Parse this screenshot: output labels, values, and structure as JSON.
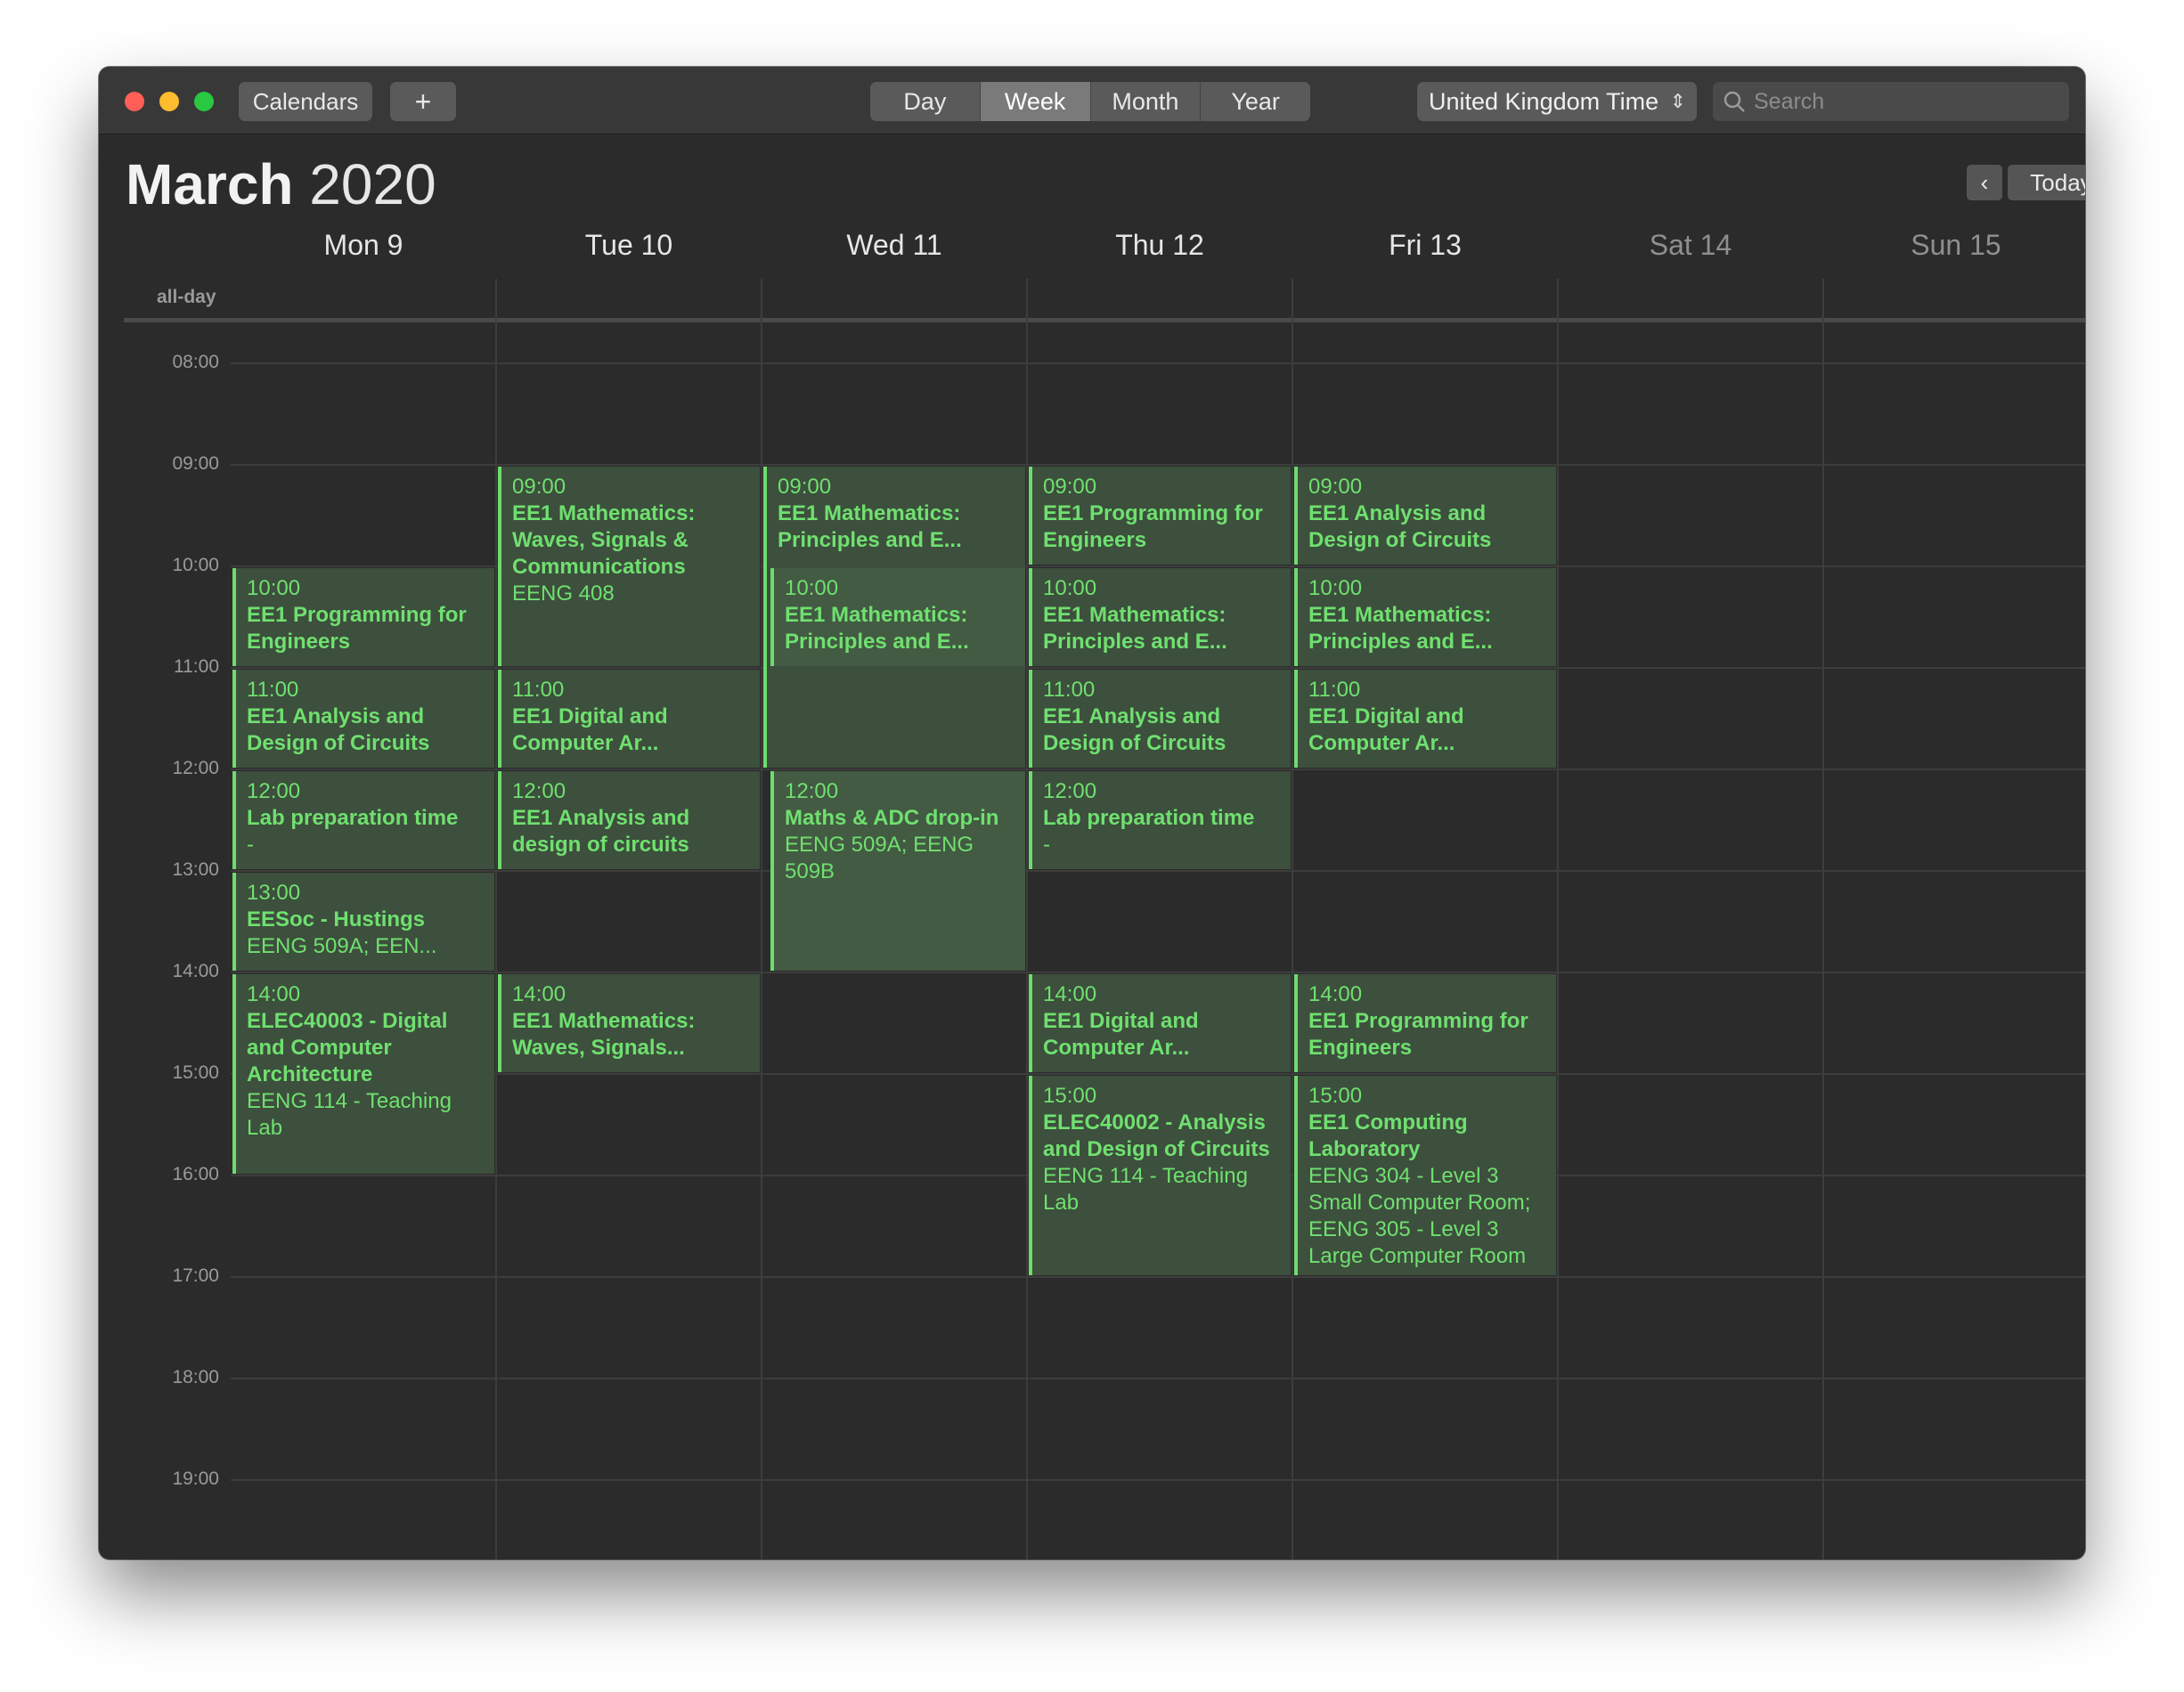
{
  "window": {
    "calendars_label": "Calendars",
    "add_label": "+",
    "views": [
      "Day",
      "Week",
      "Month",
      "Year"
    ],
    "active_view": "Week",
    "timezone": "United Kingdom Time",
    "search_placeholder": "Search"
  },
  "header": {
    "month": "March",
    "year": "2020",
    "today_label": "Today",
    "prev_label": "‹",
    "next_label": "›"
  },
  "days": [
    "Mon 9",
    "Tue 10",
    "Wed 11",
    "Thu 12",
    "Fri 13",
    "Sat 14",
    "Sun 15"
  ],
  "allday_label": "all-day",
  "hours": [
    "08:00",
    "09:00",
    "10:00",
    "11:00",
    "12:00",
    "13:00",
    "14:00",
    "15:00",
    "16:00",
    "17:00",
    "18:00",
    "19:00"
  ],
  "events": [
    {
      "day": 0,
      "start": "10:00",
      "duration": 1,
      "time": "10:00",
      "title": "EE1 Programming for Engineers",
      "location": ""
    },
    {
      "day": 0,
      "start": "11:00",
      "duration": 1,
      "time": "11:00",
      "title": "EE1 Analysis and Design of Circuits",
      "location": ""
    },
    {
      "day": 0,
      "start": "12:00",
      "duration": 1,
      "time": "12:00",
      "title": "Lab preparation time",
      "location": "-"
    },
    {
      "day": 0,
      "start": "13:00",
      "duration": 1,
      "time": "13:00",
      "title": "EESoc - Hustings",
      "location": "EENG 509A; EEN..."
    },
    {
      "day": 0,
      "start": "14:00",
      "duration": 2,
      "time": "14:00",
      "title": "ELEC40003 - Digital and Computer Architecture",
      "location": "EENG 114 - Teaching Lab"
    },
    {
      "day": 1,
      "start": "09:00",
      "duration": 2,
      "time": "09:00",
      "title": "EE1 Mathematics: Waves, Signals & Communications",
      "location": "EENG 408"
    },
    {
      "day": 1,
      "start": "11:00",
      "duration": 1,
      "time": "11:00",
      "title": "EE1 Digital and Computer Ar...",
      "location": ""
    },
    {
      "day": 1,
      "start": "12:00",
      "duration": 1,
      "time": "12:00",
      "title": "EE1 Analysis and design of circuits",
      "location": ""
    },
    {
      "day": 1,
      "start": "14:00",
      "duration": 1,
      "time": "14:00",
      "title": "EE1 Mathematics: Waves, Signals...",
      "location": ""
    },
    {
      "day": 2,
      "start": "09:00",
      "duration": 3,
      "time": "09:00",
      "title": "EE1 Mathematics: Principles and E...",
      "location": ""
    },
    {
      "day": 2,
      "start": "10:00",
      "duration": 1,
      "time": "10:00",
      "title": "EE1 Mathematics: Principles and E...",
      "location": "",
      "overlap": true
    },
    {
      "day": 2,
      "start": "12:00",
      "duration": 2,
      "time": "12:00",
      "title": "Maths & ADC drop-in",
      "location": "EENG 509A; EENG 509B",
      "overlap": true
    },
    {
      "day": 3,
      "start": "09:00",
      "duration": 1,
      "time": "09:00",
      "title": "EE1 Programming for Engineers",
      "location": ""
    },
    {
      "day": 3,
      "start": "10:00",
      "duration": 1,
      "time": "10:00",
      "title": "EE1 Mathematics: Principles and E...",
      "location": ""
    },
    {
      "day": 3,
      "start": "11:00",
      "duration": 1,
      "time": "11:00",
      "title": "EE1 Analysis and Design of Circuits",
      "location": ""
    },
    {
      "day": 3,
      "start": "12:00",
      "duration": 1,
      "time": "12:00",
      "title": "Lab preparation time",
      "location": "-"
    },
    {
      "day": 3,
      "start": "14:00",
      "duration": 1,
      "time": "14:00",
      "title": "EE1 Digital and Computer Ar...",
      "location": ""
    },
    {
      "day": 3,
      "start": "15:00",
      "duration": 2,
      "time": "15:00",
      "title": "ELEC40002 - Analysis and Design of Circuits",
      "location": "EENG 114 - Teaching Lab"
    },
    {
      "day": 4,
      "start": "09:00",
      "duration": 1,
      "time": "09:00",
      "title": "EE1 Analysis and Design of Circuits",
      "location": ""
    },
    {
      "day": 4,
      "start": "10:00",
      "duration": 1,
      "time": "10:00",
      "title": "EE1 Mathematics: Principles and E...",
      "location": ""
    },
    {
      "day": 4,
      "start": "11:00",
      "duration": 1,
      "time": "11:00",
      "title": "EE1 Digital and Computer Ar...",
      "location": ""
    },
    {
      "day": 4,
      "start": "14:00",
      "duration": 1,
      "time": "14:00",
      "title": "EE1 Programming for Engineers",
      "location": ""
    },
    {
      "day": 4,
      "start": "15:00",
      "duration": 2,
      "time": "15:00",
      "title": "EE1 Computing Laboratory",
      "location": "EENG 304 - Level 3 Small Computer Room; EENG 305 - Level 3 Large Computer Room"
    }
  ]
}
